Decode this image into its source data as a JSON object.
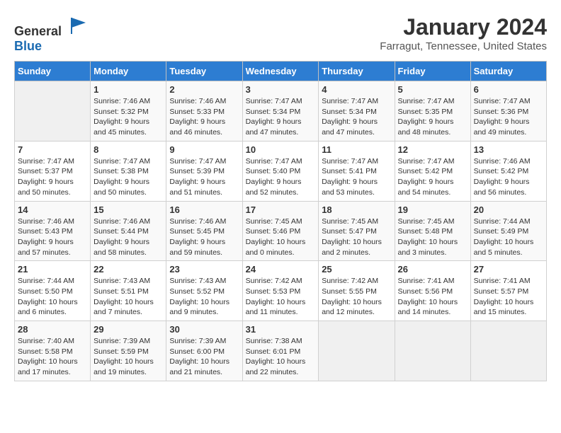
{
  "logo": {
    "general": "General",
    "blue": "Blue"
  },
  "title": "January 2024",
  "location": "Farragut, Tennessee, United States",
  "days_of_week": [
    "Sunday",
    "Monday",
    "Tuesday",
    "Wednesday",
    "Thursday",
    "Friday",
    "Saturday"
  ],
  "weeks": [
    [
      {
        "day": "",
        "info": ""
      },
      {
        "day": "1",
        "info": "Sunrise: 7:46 AM\nSunset: 5:32 PM\nDaylight: 9 hours\nand 45 minutes."
      },
      {
        "day": "2",
        "info": "Sunrise: 7:46 AM\nSunset: 5:33 PM\nDaylight: 9 hours\nand 46 minutes."
      },
      {
        "day": "3",
        "info": "Sunrise: 7:47 AM\nSunset: 5:34 PM\nDaylight: 9 hours\nand 47 minutes."
      },
      {
        "day": "4",
        "info": "Sunrise: 7:47 AM\nSunset: 5:34 PM\nDaylight: 9 hours\nand 47 minutes."
      },
      {
        "day": "5",
        "info": "Sunrise: 7:47 AM\nSunset: 5:35 PM\nDaylight: 9 hours\nand 48 minutes."
      },
      {
        "day": "6",
        "info": "Sunrise: 7:47 AM\nSunset: 5:36 PM\nDaylight: 9 hours\nand 49 minutes."
      }
    ],
    [
      {
        "day": "7",
        "info": "Sunrise: 7:47 AM\nSunset: 5:37 PM\nDaylight: 9 hours\nand 50 minutes."
      },
      {
        "day": "8",
        "info": "Sunrise: 7:47 AM\nSunset: 5:38 PM\nDaylight: 9 hours\nand 50 minutes."
      },
      {
        "day": "9",
        "info": "Sunrise: 7:47 AM\nSunset: 5:39 PM\nDaylight: 9 hours\nand 51 minutes."
      },
      {
        "day": "10",
        "info": "Sunrise: 7:47 AM\nSunset: 5:40 PM\nDaylight: 9 hours\nand 52 minutes."
      },
      {
        "day": "11",
        "info": "Sunrise: 7:47 AM\nSunset: 5:41 PM\nDaylight: 9 hours\nand 53 minutes."
      },
      {
        "day": "12",
        "info": "Sunrise: 7:47 AM\nSunset: 5:42 PM\nDaylight: 9 hours\nand 54 minutes."
      },
      {
        "day": "13",
        "info": "Sunrise: 7:46 AM\nSunset: 5:42 PM\nDaylight: 9 hours\nand 56 minutes."
      }
    ],
    [
      {
        "day": "14",
        "info": "Sunrise: 7:46 AM\nSunset: 5:43 PM\nDaylight: 9 hours\nand 57 minutes."
      },
      {
        "day": "15",
        "info": "Sunrise: 7:46 AM\nSunset: 5:44 PM\nDaylight: 9 hours\nand 58 minutes."
      },
      {
        "day": "16",
        "info": "Sunrise: 7:46 AM\nSunset: 5:45 PM\nDaylight: 9 hours\nand 59 minutes."
      },
      {
        "day": "17",
        "info": "Sunrise: 7:45 AM\nSunset: 5:46 PM\nDaylight: 10 hours\nand 0 minutes."
      },
      {
        "day": "18",
        "info": "Sunrise: 7:45 AM\nSunset: 5:47 PM\nDaylight: 10 hours\nand 2 minutes."
      },
      {
        "day": "19",
        "info": "Sunrise: 7:45 AM\nSunset: 5:48 PM\nDaylight: 10 hours\nand 3 minutes."
      },
      {
        "day": "20",
        "info": "Sunrise: 7:44 AM\nSunset: 5:49 PM\nDaylight: 10 hours\nand 5 minutes."
      }
    ],
    [
      {
        "day": "21",
        "info": "Sunrise: 7:44 AM\nSunset: 5:50 PM\nDaylight: 10 hours\nand 6 minutes."
      },
      {
        "day": "22",
        "info": "Sunrise: 7:43 AM\nSunset: 5:51 PM\nDaylight: 10 hours\nand 7 minutes."
      },
      {
        "day": "23",
        "info": "Sunrise: 7:43 AM\nSunset: 5:52 PM\nDaylight: 10 hours\nand 9 minutes."
      },
      {
        "day": "24",
        "info": "Sunrise: 7:42 AM\nSunset: 5:53 PM\nDaylight: 10 hours\nand 11 minutes."
      },
      {
        "day": "25",
        "info": "Sunrise: 7:42 AM\nSunset: 5:55 PM\nDaylight: 10 hours\nand 12 minutes."
      },
      {
        "day": "26",
        "info": "Sunrise: 7:41 AM\nSunset: 5:56 PM\nDaylight: 10 hours\nand 14 minutes."
      },
      {
        "day": "27",
        "info": "Sunrise: 7:41 AM\nSunset: 5:57 PM\nDaylight: 10 hours\nand 15 minutes."
      }
    ],
    [
      {
        "day": "28",
        "info": "Sunrise: 7:40 AM\nSunset: 5:58 PM\nDaylight: 10 hours\nand 17 minutes."
      },
      {
        "day": "29",
        "info": "Sunrise: 7:39 AM\nSunset: 5:59 PM\nDaylight: 10 hours\nand 19 minutes."
      },
      {
        "day": "30",
        "info": "Sunrise: 7:39 AM\nSunset: 6:00 PM\nDaylight: 10 hours\nand 21 minutes."
      },
      {
        "day": "31",
        "info": "Sunrise: 7:38 AM\nSunset: 6:01 PM\nDaylight: 10 hours\nand 22 minutes."
      },
      {
        "day": "",
        "info": ""
      },
      {
        "day": "",
        "info": ""
      },
      {
        "day": "",
        "info": ""
      }
    ]
  ]
}
